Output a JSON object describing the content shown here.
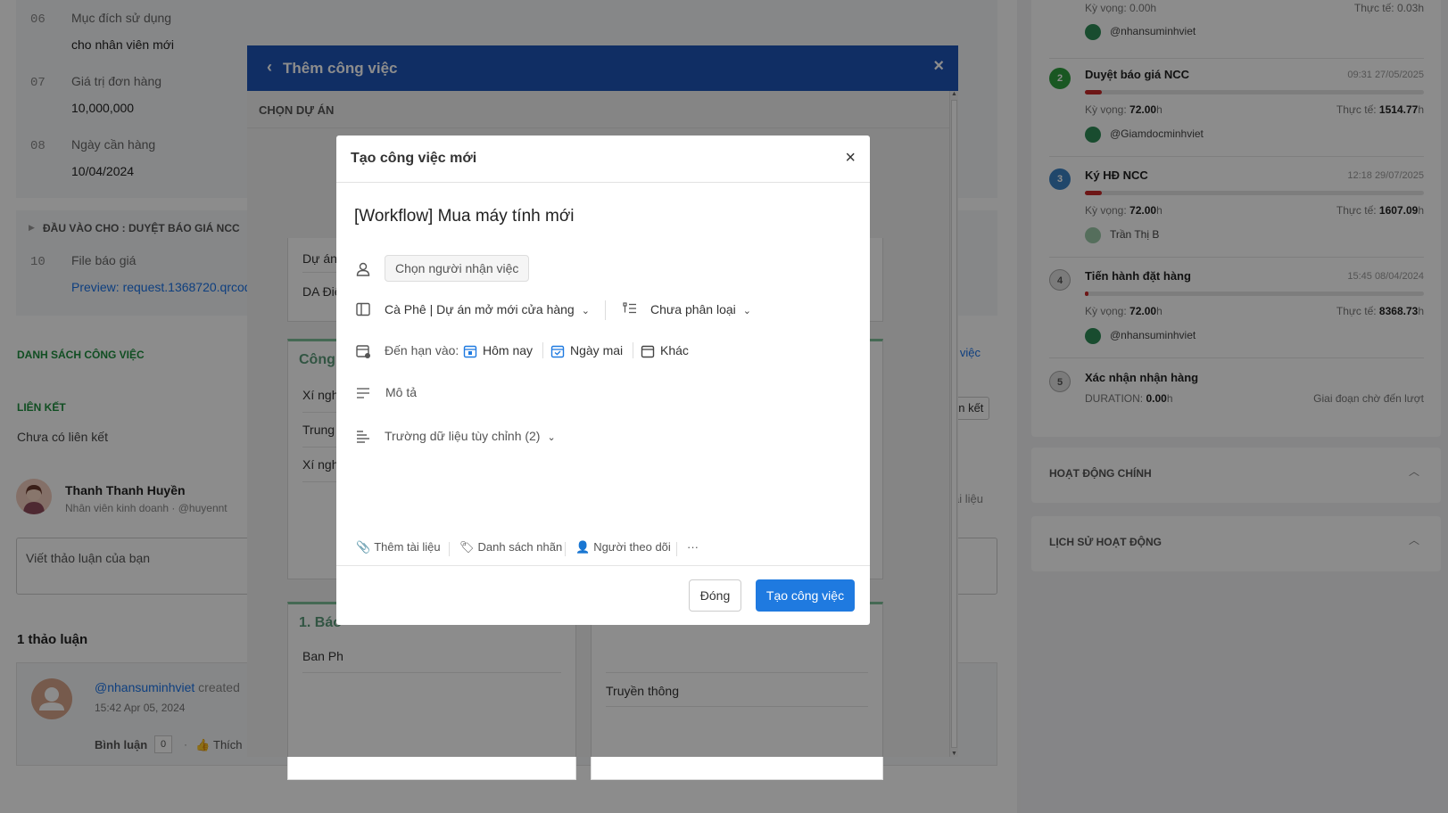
{
  "background": {
    "info_rows": [
      {
        "num": "06",
        "label": "Mục đích sử dụng",
        "value": "cho nhân viên mới"
      },
      {
        "num": "07",
        "label": "Giá trị đơn hàng",
        "value": "10,000,000"
      },
      {
        "num": "08",
        "label": "Ngày cần hàng",
        "value": "10/04/2024"
      }
    ],
    "input_header": "ĐẦU VÀO CHO : DUYỆT BÁO GIÁ NCC",
    "file_row": {
      "num": "10",
      "label": "File báo giá",
      "value": "Preview: request.1368720.qrcode"
    },
    "task_list_header": "DANH SÁCH CÔNG VIỆC",
    "links_header": "LIÊN KẾT",
    "links_empty": "Chưa có liên kết",
    "user_name": "Thanh Thanh Huyền",
    "user_role": "Nhân viên kinh doanh · @huyennt",
    "comment_placeholder": "Viết thảo luận của bạn",
    "discussion_count": "1 thảo luận",
    "discussion": {
      "author": "@nhansuminhviet",
      "action": "created",
      "time": "15:42 Apr 05, 2024",
      "comment_label": "Bình luận",
      "comment_count": "0",
      "like_label": "Thích"
    },
    "side_peek_1": "g việc",
    "side_peek_2": "ên kết",
    "side_peek_3": "ài liệu",
    "steps": {
      "top_partial": {
        "expected": "Kỳ vọng: 0.00h",
        "actual": "Thực tế: 0.03h",
        "user": "@nhansuminhviet"
      },
      "items": [
        {
          "num": "2",
          "title": "Duyệt báo giá NCC",
          "time": "09:31 27/05/2025",
          "expected": "72.00",
          "actual": "1514.77",
          "user": "@Giamdocminhviet",
          "color": "#2e9e3e",
          "progress": 0.05
        },
        {
          "num": "3",
          "title": "Ký HĐ NCC",
          "time": "12:18 29/07/2025",
          "expected": "72.00",
          "actual": "1607.09",
          "user": "Trần Thị B",
          "color": "#3b82c4",
          "progress": 0.05
        },
        {
          "num": "4",
          "title": "Tiến hành đặt hàng",
          "time": "15:45 08/04/2024",
          "expected": "72.00",
          "actual": "8368.73",
          "user": "@nhansuminhviet",
          "color": "#9e9e9e",
          "progress": 0.01
        },
        {
          "num": "5",
          "title": "Xác nhận nhận hàng",
          "duration_label": "DURATION:",
          "duration": "0.00",
          "status": "Giai đoạn chờ đến lượt",
          "color": "#9e9e9e"
        }
      ],
      "expected_prefix": "Kỳ vọng:",
      "actual_prefix": "Thực tế:",
      "hour_unit": "h"
    },
    "main_activity": "HOẠT ĐỘNG CHÍNH",
    "activity_history": "LỊCH SỬ HOẠT ĐỘNG"
  },
  "outer_modal": {
    "title": "Thêm công việc",
    "subheader": "CHỌN DỰ ÁN",
    "cards": {
      "top_left_rows": [
        "Dự án",
        "DA Điệ"
      ],
      "mid_left_head": "Công",
      "mid_left_rows": [
        "Xí ngh",
        "Trung",
        "Xí ngh"
      ],
      "bottom_left_head": "1. Báo",
      "bottom_left_rows": [
        "Ban Ph"
      ],
      "bottom_right_rows": [
        "Truyền thông"
      ]
    }
  },
  "inner_modal": {
    "title": "Tạo công việc mới",
    "task_name": "[Workflow] Mua máy tính mới",
    "assignee_placeholder": "Chọn người nhận việc",
    "project": "Cà Phê | Dự án mở mới cửa hàng",
    "category": "Chưa phân loại",
    "due_label": "Đến hạn vào:",
    "due_today": "Hôm nay",
    "due_tomorrow": "Ngày mai",
    "due_other": "Khác",
    "description": "Mô tả",
    "custom_fields": "Trường dữ liệu tùy chỉnh (2)",
    "toolbar": {
      "attach": "Thêm tài liệu",
      "labels": "Danh sách nhãn",
      "followers": "Người theo dõi",
      "more": "···"
    },
    "close_label": "Đóng",
    "create_label": "Tạo công việc"
  }
}
